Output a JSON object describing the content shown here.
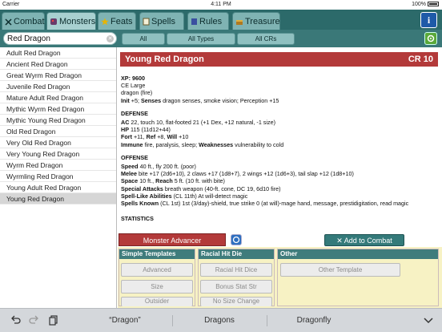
{
  "status_bar": {
    "carrier": "Carrier",
    "time": "4:11 PM",
    "battery": "100%"
  },
  "tabs": [
    {
      "label": "Combat",
      "selected": false
    },
    {
      "label": "Monsters",
      "selected": true
    },
    {
      "label": "Feats",
      "selected": false
    },
    {
      "label": "Spells",
      "selected": false
    },
    {
      "label": "Rules",
      "selected": false
    },
    {
      "label": "Treasure",
      "selected": false
    }
  ],
  "info_label": "i",
  "filter": {
    "search_value": "Red Dragon",
    "all_label": "All",
    "types_label": "All Types",
    "crs_label": "All CRs"
  },
  "monster_list": [
    {
      "name": "Adult Red Dragon",
      "selected": false
    },
    {
      "name": "Ancient Red Dragon",
      "selected": false
    },
    {
      "name": "Great Wyrm Red Dragon",
      "selected": false
    },
    {
      "name": "Juvenile Red Dragon",
      "selected": false
    },
    {
      "name": "Mature Adult Red Dragon",
      "selected": false
    },
    {
      "name": "Mythic Wyrm Red Dragon",
      "selected": false
    },
    {
      "name": "Mythic Young Red Dragon",
      "selected": false
    },
    {
      "name": "Old Red Dragon",
      "selected": false
    },
    {
      "name": "Very Old Red Dragon",
      "selected": false
    },
    {
      "name": "Very Young Red Dragon",
      "selected": false
    },
    {
      "name": "Wyrm Red Dragon",
      "selected": false
    },
    {
      "name": "Wyrmling Red Dragon",
      "selected": false
    },
    {
      "name": "Young Adult Red Dragon",
      "selected": false
    },
    {
      "name": "Young Red Dragon",
      "selected": true
    }
  ],
  "detail": {
    "name": "Young Red Dragon",
    "cr": "CR 10",
    "xp_label": "XP: 9600",
    "alignment_size": "CE Large",
    "type": "dragon (fire)",
    "init_label": "Init",
    "init_value": "+5;",
    "senses_label": "Senses",
    "senses_value": "dragon senses, smoke vision; Perception +15",
    "defense_heading": "DEFENSE",
    "ac_label": "AC",
    "ac_value": "22,  touch 10,  flat-footed 21 (+1 Dex, +12 natural, -1 size)",
    "hp_label": "HP",
    "hp_value": "115 (11d12+44)",
    "fort_label": "Fort",
    "fort_value": "+11,",
    "ref_label": "Ref",
    "ref_value": "+8,",
    "will_label": "Will",
    "will_value": "+10",
    "immune_label": "Immune",
    "immune_value": "fire, paralysis, sleep;",
    "weak_label": "Weaknesses",
    "weak_value": "vulnerability to cold",
    "offense_heading": "OFFENSE",
    "speed_label": "Speed",
    "speed_value": "40 ft., fly 200 ft. (poor)",
    "melee_label": "Melee",
    "melee_value": "bite +17 (2d6+10), 2 claws +17 (1d8+7), 2 wings +12 (1d6+3), tail slap +12 (1d8+10)",
    "space_label": "Space",
    "space_value": "10 ft.,",
    "reach_label": "Reach",
    "reach_value": "5 ft. (10 ft. with bite)",
    "special_label": "Special Attacks",
    "special_value": "breath weapon (40-ft. cone, DC 19, 6d10 fire)",
    "sla_label": "Spell-Like Abilities",
    "sla_value": "(CL 11th) At will-detect magic",
    "spells_label": "Spells Known",
    "spells_value": "(CL 1st) 1st (3/day)-shield, true strike 0 (at will)-mage hand, message, prestidigitation, read magic",
    "statistics_heading": "STATISTICS"
  },
  "advancer": {
    "button_label": "Monster Advancer",
    "add_label": "Add to Combat",
    "simple_templates": {
      "title": "Simple Templates",
      "buttons": [
        "Advanced",
        "Size",
        "Outsider"
      ]
    },
    "racial_hit_die": {
      "title": "Racial Hit Die",
      "buttons": [
        "Racial Hit Dice",
        "Bonus Stat Str",
        "No Size Change"
      ]
    },
    "other": {
      "title": "Other",
      "buttons": [
        "Other Template"
      ]
    }
  },
  "keyboard_bar": {
    "suggestions": [
      "“Dragon”",
      "Dragons",
      "Dragonfly"
    ]
  },
  "colors": {
    "nav_teal": "#2c6a6a",
    "header_red": "#b33a3a",
    "panel_yellow": "#f7f2c4",
    "info_blue": "#1e5aa8"
  }
}
